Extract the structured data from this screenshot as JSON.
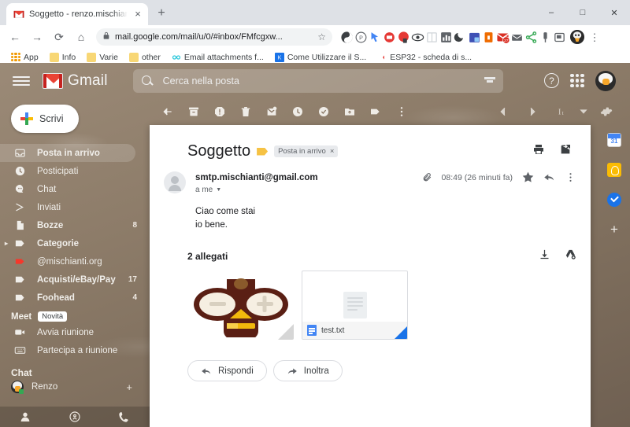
{
  "browser": {
    "tab": {
      "title": "Soggetto - renzo.mischianti@gm",
      "favicon": "gmail-icon",
      "close": "×"
    },
    "new_tab_label": "+",
    "window_controls": {
      "minimize": "–",
      "maximize": "□",
      "close": "✕"
    },
    "nav": {
      "back": "←",
      "forward": "→",
      "reload": "⟳",
      "home": "⌂"
    },
    "omnibox": {
      "lock": "lock-icon",
      "url": "mail.google.com/mail/u/0/#inbox/FMfcgxw...",
      "star": "☆"
    },
    "extensions": [
      {
        "name": "ext-yin-yang",
        "color": "#3c4043"
      },
      {
        "name": "ext-pinterest",
        "color": "#555"
      },
      {
        "name": "ext-cursor",
        "color": "#4285f4"
      },
      {
        "name": "ext-mail-red",
        "color": "#e53935"
      },
      {
        "name": "ext-notify-red",
        "color": "#e53935"
      },
      {
        "name": "ext-eye",
        "color": "#3c4043"
      },
      {
        "name": "ext-book",
        "color": "#cfd4d8"
      },
      {
        "name": "ext-chart",
        "color": "#5f6368"
      },
      {
        "name": "ext-moon",
        "color": "#3c4043"
      },
      {
        "name": "ext-calendar-blue",
        "color": "#3f51b5"
      },
      {
        "name": "ext-lock-orange",
        "color": "#ef6c00"
      },
      {
        "name": "ext-gmail-badge",
        "color": "#d93025"
      },
      {
        "name": "ext-envelope-grey",
        "color": "#5f6368"
      },
      {
        "name": "ext-share",
        "color": "#34a853"
      },
      {
        "name": "ext-pin",
        "color": "#5f6368"
      },
      {
        "name": "ext-window",
        "color": "#5f6368"
      }
    ],
    "profile_avatar": "profile-avatar",
    "menu": "⋮",
    "bookmarks": [
      {
        "label": "App",
        "icon": "apps-grid-icon"
      },
      {
        "label": "Info",
        "icon": "folder-icon"
      },
      {
        "label": "Varie",
        "icon": "folder-icon"
      },
      {
        "label": "other",
        "icon": "folder-icon"
      },
      {
        "label": "Email attachments f...",
        "icon": "link-icon"
      },
      {
        "label": "Come Utilizzare il S...",
        "icon": "k-icon"
      },
      {
        "label": "ESP32 - scheda di s...",
        "icon": "pin-icon"
      }
    ]
  },
  "gmail": {
    "brand": "Gmail",
    "search": {
      "placeholder": "Cerca nella posta",
      "icon": "search-icon",
      "filter_icon": "filter-icon"
    },
    "top_right": {
      "help": "?",
      "apps": "apps-grid-icon",
      "avatar": "account-avatar"
    },
    "compose": {
      "label": "Scrivi",
      "icon": "plus-icon"
    },
    "nav_items": [
      {
        "label": "Posta in arrivo",
        "icon": "inbox-icon",
        "count": "",
        "selected": true,
        "bold": true
      },
      {
        "label": "Posticipati",
        "icon": "clock-icon",
        "count": "",
        "selected": false,
        "bold": false
      },
      {
        "label": "Chat",
        "icon": "chat-icon",
        "count": "",
        "selected": false,
        "bold": false
      },
      {
        "label": "Inviati",
        "icon": "send-icon",
        "count": "",
        "selected": false,
        "bold": false
      },
      {
        "label": "Bozze",
        "icon": "draft-icon",
        "count": "8",
        "selected": false,
        "bold": true
      },
      {
        "label": "Categorie",
        "icon": "label-icon",
        "count": "",
        "selected": false,
        "bold": true,
        "expandable": true
      },
      {
        "label": "@mischianti.org",
        "icon": "label-red-icon",
        "count": "",
        "selected": false,
        "bold": false
      },
      {
        "label": "Acquisti/eBay/Pay",
        "icon": "label-icon",
        "count": "17",
        "selected": false,
        "bold": true
      },
      {
        "label": "Foohead",
        "icon": "label-icon",
        "count": "4",
        "selected": false,
        "bold": true
      }
    ],
    "meet": {
      "title": "Meet",
      "badge": "Novità",
      "items": [
        {
          "label": "Avvia riunione",
          "icon": "video-icon"
        },
        {
          "label": "Partecipa a riunione",
          "icon": "keyboard-icon"
        }
      ]
    },
    "chat": {
      "title": "Chat",
      "user": "Renzo",
      "add": "+"
    },
    "sidebar_footer": [
      {
        "name": "contacts-icon"
      },
      {
        "name": "location-icon"
      },
      {
        "name": "phone-icon"
      }
    ],
    "toolbar": [
      {
        "name": "back-icon"
      },
      {
        "name": "archive-icon"
      },
      {
        "name": "report-spam-icon"
      },
      {
        "name": "delete-icon"
      },
      {
        "name": "mark-unread-icon"
      },
      {
        "name": "snooze-icon"
      },
      {
        "name": "add-task-icon"
      },
      {
        "name": "move-to-icon"
      },
      {
        "name": "labels-icon"
      },
      {
        "name": "more-icon"
      }
    ],
    "toolbar_right": [
      {
        "name": "prev-page-icon"
      },
      {
        "name": "next-page-icon"
      },
      {
        "name": "input-tools-icon"
      },
      {
        "name": "chevron-down-icon"
      },
      {
        "name": "settings-gear-icon"
      }
    ],
    "right_rail": [
      {
        "name": "calendar-icon",
        "label": "31"
      },
      {
        "name": "keep-icon"
      },
      {
        "name": "tasks-icon"
      },
      {
        "name": "add-app-icon",
        "label": "+"
      }
    ]
  },
  "message": {
    "subject": "Soggetto",
    "label_chip": "Posta in arrivo",
    "label_chip_close": "×",
    "print_icon": "print-icon",
    "popout_icon": "open-in-new-icon",
    "sender": "smtp.mischianti@gmail.com",
    "to_line": "a me",
    "time": "08:49 (26 minuti fa)",
    "attachment_indicator": "paperclip-icon",
    "star_icon": "star-icon",
    "reply_icon": "reply-icon",
    "more_icon": "more-vert-icon",
    "body_lines": [
      "Ciao come stai",
      "io bene."
    ],
    "attachments": {
      "title": "2 allegati",
      "download_all_icon": "download-icon",
      "save_to_drive_icon": "add-to-drive-icon",
      "items": [
        {
          "name": "",
          "type": "image",
          "preview": "bee-logo"
        },
        {
          "name": "test.txt",
          "type": "text",
          "preview": "document-placeholder"
        }
      ]
    },
    "actions": [
      {
        "label": "Rispondi",
        "icon": "reply-icon"
      },
      {
        "label": "Inoltra",
        "icon": "forward-icon"
      }
    ]
  },
  "colors": {
    "gmail_red": "#ea4335",
    "accent_blue": "#1a73e8",
    "chip_bg": "#e8eaed",
    "label_yellow": "#f6c244"
  }
}
